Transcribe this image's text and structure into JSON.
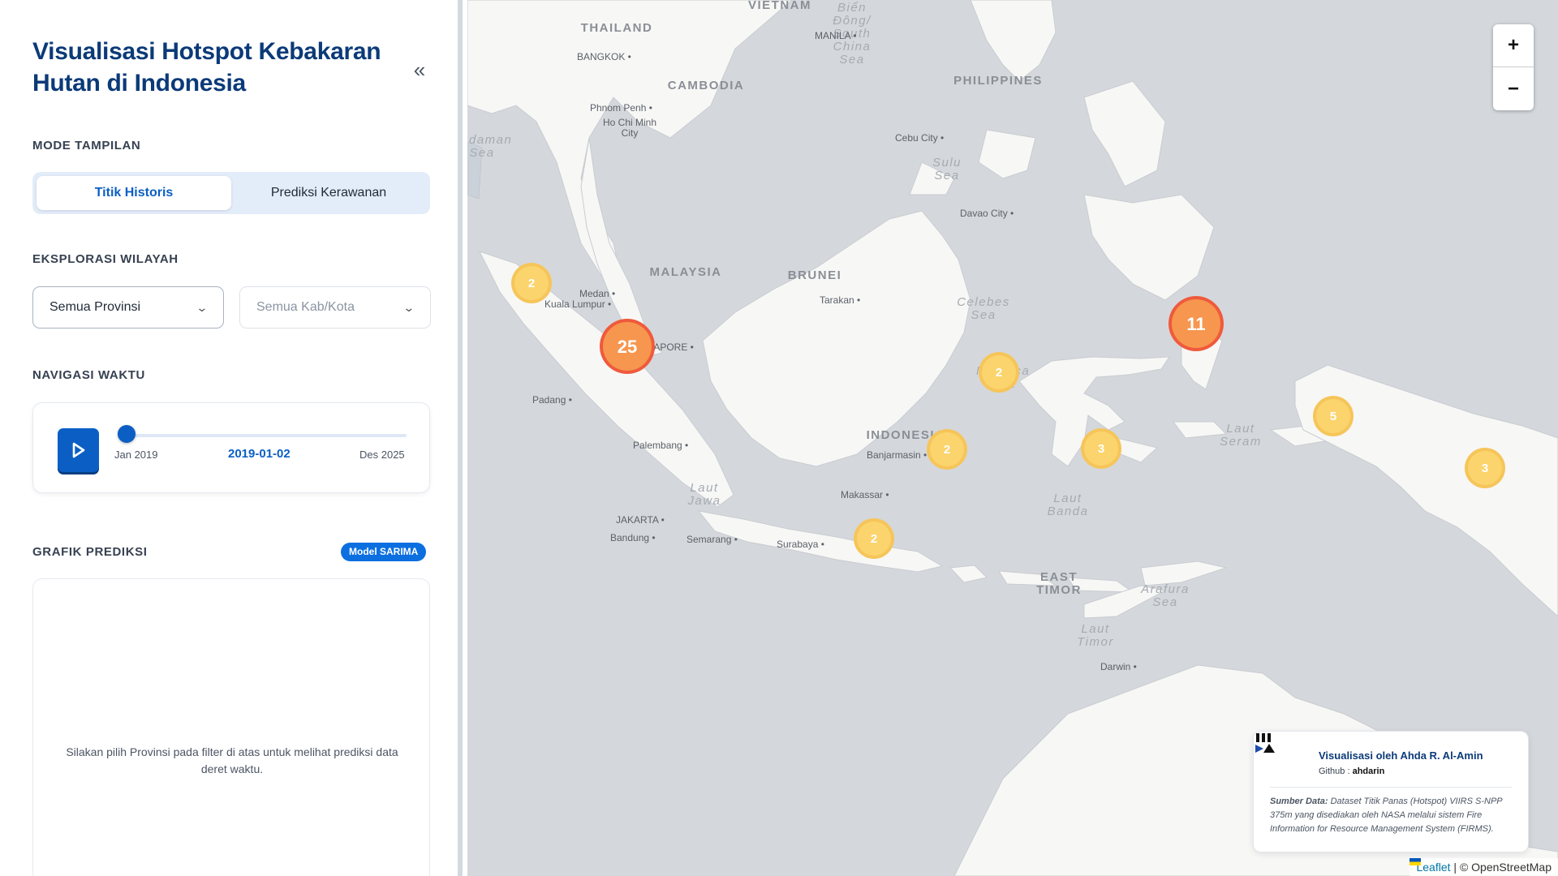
{
  "sidebar": {
    "title": "Visualisasi Hotspot Kebakaran Hutan di Indonesia",
    "collapse_label": "«",
    "mode_section": "MODE TAMPILAN",
    "modes": [
      {
        "label": "Titik Historis",
        "active": true
      },
      {
        "label": "Prediksi Kerawanan",
        "active": false
      }
    ],
    "region_section": "EKSPLORASI WILAYAH",
    "province_select": {
      "value": "Semua Provinsi"
    },
    "city_select": {
      "value": "Semua Kab/Kota"
    },
    "time_section": "NAVIGASI WAKTU",
    "time": {
      "start_label": "Jan 2019",
      "end_label": "Des 2025",
      "current": "2019-01-02",
      "progress": 0.01
    },
    "chart_section": "GRAFIK PREDIKSI",
    "model_badge": "Model SARIMA",
    "chart_empty_text": "Silakan pilih Provinsi pada filter di atas untuk melihat prediksi data deret waktu."
  },
  "map": {
    "zoom_in": "+",
    "zoom_out": "−",
    "labels": [
      {
        "text": "VIETNAM",
        "kind": "country"
      },
      {
        "text": "THAILAND",
        "kind": "country"
      },
      {
        "text": "CAMBODIA",
        "kind": "country"
      },
      {
        "text": "MALAYSIA",
        "kind": "country"
      },
      {
        "text": "BRUNEI",
        "kind": "country"
      },
      {
        "text": "PHILIPPINES",
        "kind": "country"
      },
      {
        "text": "INDONESIA",
        "kind": "country"
      },
      {
        "text": "EAST TIMOR",
        "kind": "country"
      },
      {
        "text": "Biển Đông/ South China Sea",
        "kind": "sea"
      },
      {
        "text": "Andaman Sea",
        "kind": "sea"
      },
      {
        "text": "Sulu Sea",
        "kind": "sea"
      },
      {
        "text": "Celebes Sea",
        "kind": "sea"
      },
      {
        "text": "Molucca Sea",
        "kind": "sea"
      },
      {
        "text": "Laut Seram",
        "kind": "sea"
      },
      {
        "text": "Laut Banda",
        "kind": "sea"
      },
      {
        "text": "Laut Jawa",
        "kind": "sea"
      },
      {
        "text": "Laut Timor",
        "kind": "sea"
      },
      {
        "text": "Arafura Sea",
        "kind": "sea"
      },
      {
        "text": "BANGKOK",
        "kind": "city"
      },
      {
        "text": "MANILA",
        "kind": "city"
      },
      {
        "text": "Phnom Penh",
        "kind": "city"
      },
      {
        "text": "Ho Chi Minh City",
        "kind": "city"
      },
      {
        "text": "Cebu City",
        "kind": "city"
      },
      {
        "text": "Davao City",
        "kind": "city"
      },
      {
        "text": "Kuala Lumpur",
        "kind": "city"
      },
      {
        "text": "SINGAPORE",
        "kind": "city"
      },
      {
        "text": "Medan",
        "kind": "city"
      },
      {
        "text": "Padang",
        "kind": "city"
      },
      {
        "text": "Palembang",
        "kind": "city"
      },
      {
        "text": "JAKARTA",
        "kind": "city"
      },
      {
        "text": "Bandung",
        "kind": "city"
      },
      {
        "text": "Semarang",
        "kind": "city"
      },
      {
        "text": "Surabaya",
        "kind": "city"
      },
      {
        "text": "Banjarmasin",
        "kind": "city"
      },
      {
        "text": "Tarakan",
        "kind": "city"
      },
      {
        "text": "Makassar",
        "kind": "city"
      },
      {
        "text": "Darwin",
        "kind": "city"
      }
    ],
    "clusters": [
      {
        "count": 2,
        "level": "low"
      },
      {
        "count": 25,
        "level": "high"
      },
      {
        "count": 11,
        "level": "high"
      },
      {
        "count": 2,
        "level": "low"
      },
      {
        "count": 2,
        "level": "low"
      },
      {
        "count": 3,
        "level": "low"
      },
      {
        "count": 5,
        "level": "low"
      },
      {
        "count": 3,
        "level": "low"
      },
      {
        "count": 2,
        "level": "low"
      }
    ],
    "colors": {
      "sea": "#d4d8dc",
      "land": "#f7f7f6",
      "cluster_low": "#fbd46d",
      "cluster_high": "#f7964e"
    },
    "credit": {
      "author": "Visualisasi oleh Ahda R. Al-Amin",
      "github_prefix": "Github : ",
      "github_user": "ahdarin",
      "source_title": "Sumber Data:",
      "source_text": "Dataset Titik Panas (Hotspot) VIIRS S-NPP 375m yang disediakan oleh NASA melalui sistem Fire Information for Resource Management System (FIRMS)."
    },
    "attribution": {
      "leaflet": "Leaflet",
      "osm": "| © OpenStreetMap"
    }
  }
}
